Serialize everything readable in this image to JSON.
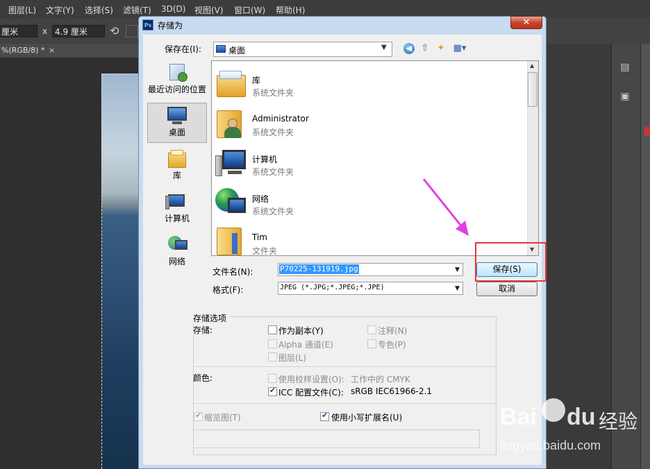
{
  "photoshop": {
    "menu": [
      "图层(L)",
      "文字(Y)",
      "选择(S)",
      "滤镜(T)",
      "3D(D)",
      "视图(V)",
      "窗口(W)",
      "帮助(H)"
    ],
    "options": {
      "width_value": "厘米",
      "x_label": "x",
      "height_value": "4.9 厘米"
    },
    "doc_tab": {
      "label": "%(RGB/8) *",
      "close": "×"
    }
  },
  "dialog": {
    "title": "存储为",
    "ps_badge": "Ps",
    "close": "✕",
    "save_in_label": "保存在(I):",
    "save_in_value": "桌面",
    "places": [
      {
        "label": "最近访问的位置",
        "icon": "recent-places-icon"
      },
      {
        "label": "桌面",
        "icon": "desktop-icon",
        "selected": true
      },
      {
        "label": "库",
        "icon": "libraries-icon"
      },
      {
        "label": "计算机",
        "icon": "computer-icon"
      },
      {
        "label": "网络",
        "icon": "network-icon"
      }
    ],
    "files": [
      {
        "name": "库",
        "type": "系统文件夹",
        "icon": "libraries-folder-icon"
      },
      {
        "name": "Administrator",
        "type": "系统文件夹",
        "icon": "user-folder-icon"
      },
      {
        "name": "计算机",
        "type": "系统文件夹",
        "icon": "computer-icon"
      },
      {
        "name": "网络",
        "type": "系统文件夹",
        "icon": "network-icon"
      },
      {
        "name": "Tim",
        "type": "文件夹",
        "icon": "folder-icon"
      }
    ],
    "filename_label": "文件名(N):",
    "filename_value": "P70225-131919.jpg",
    "format_label": "格式(F):",
    "format_value": "JPEG (*.JPG;*.JPEG;*.JPE)",
    "save_button": "保存(S)",
    "cancel_button": "取消",
    "options": {
      "section_title": "存储选项",
      "store_label": "存储:",
      "as_copy": {
        "label": "作为副本(Y)",
        "checked": false,
        "enabled": true
      },
      "notes": {
        "label": "注释(N)",
        "checked": false,
        "enabled": false
      },
      "alpha": {
        "label": "Alpha 通道(E)",
        "checked": false,
        "enabled": false
      },
      "spot": {
        "label": "专色(P)",
        "checked": false,
        "enabled": false
      },
      "layers": {
        "label": "图层(L)",
        "checked": false,
        "enabled": false
      },
      "color_label": "颜色:",
      "proof": {
        "label": "使用校样设置(O):",
        "value": "工作中的 CMYK",
        "checked": false,
        "enabled": false
      },
      "icc": {
        "label": "ICC 配置文件(C):",
        "value": "sRGB IEC61966-2.1",
        "checked": true,
        "enabled": true
      },
      "thumbnail": {
        "label": "缩览图(T)",
        "checked": true,
        "enabled": false
      },
      "lowercase": {
        "label": "使用小写扩展名(U)",
        "checked": true,
        "enabled": true
      }
    }
  },
  "watermark": {
    "brand": "Bai",
    "brand_tail": "du",
    "sub": "经验",
    "url": "jingyan.baidu.com"
  },
  "colors": {
    "highlight_box": "#e6353b",
    "arrow": "#e040e0",
    "selection": "#3399ff"
  }
}
